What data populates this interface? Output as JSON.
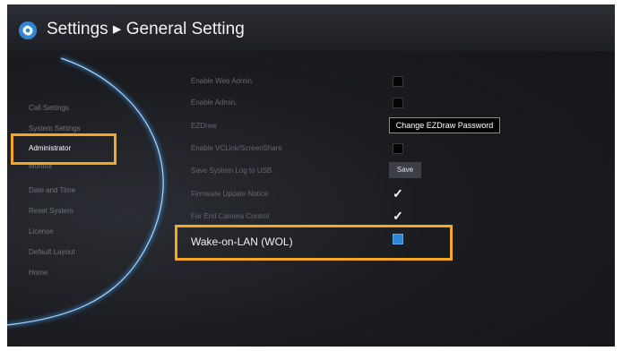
{
  "header": {
    "title": "Settings ▸ General Setting",
    "icon": "gear-icon"
  },
  "sidebar": {
    "items": [
      {
        "label": "Call Settings",
        "active": false
      },
      {
        "label": "System Settings",
        "active": false
      },
      {
        "label": "Administrator",
        "active": true
      },
      {
        "label": "Monitor",
        "active": false
      },
      {
        "label": "Date and Time",
        "active": false
      },
      {
        "label": "Reset System",
        "active": false
      },
      {
        "label": "License",
        "active": false
      },
      {
        "label": "Default Layout",
        "active": false
      },
      {
        "label": "Home",
        "active": false
      }
    ]
  },
  "settings": {
    "enable_web_admin": {
      "label": "Enable Web Admin.",
      "checked": false
    },
    "enable_admin": {
      "label": "Enable Admin.",
      "checked": false
    },
    "ezdraw": {
      "label": "EZDraw",
      "button": "Change EZDraw Password"
    },
    "enable_vclink": {
      "label": "Enable VCLink/ScreenShare",
      "checked": false
    },
    "save_log": {
      "label": "Save System Log to USB",
      "button": "Save"
    },
    "firmware_notice": {
      "label": "Firmware Update Notice",
      "checked": true
    },
    "far_end_camera": {
      "label": "Far End Camera Control",
      "checked": true
    },
    "wol": {
      "label": "Wake-on-LAN (WOL)",
      "checked": true
    }
  },
  "colors": {
    "highlight": "#f5a623",
    "accent": "#2f86d4",
    "background": "#1b1c20"
  }
}
